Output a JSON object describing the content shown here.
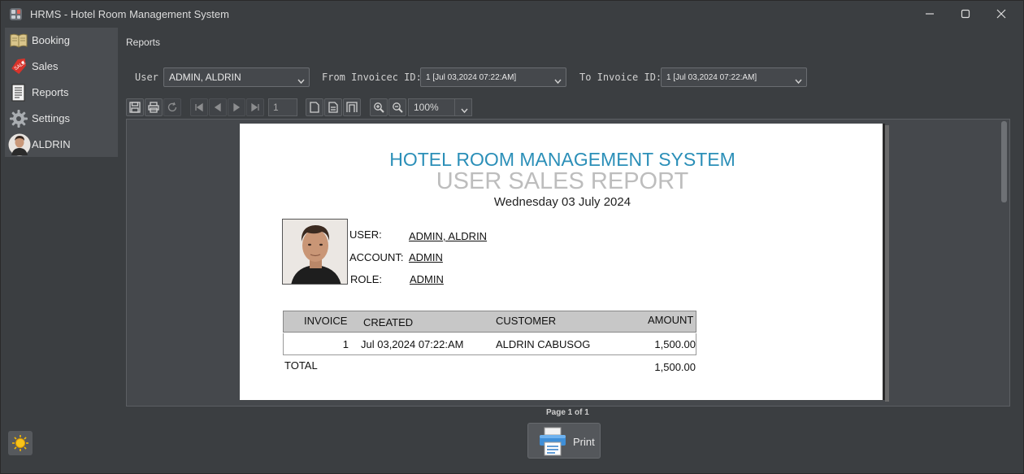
{
  "window": {
    "title": "HRMS - Hotel Room Management System"
  },
  "sidebar": {
    "items": [
      {
        "label": "Booking",
        "icon": "book-icon"
      },
      {
        "label": "Sales",
        "icon": "sale-tag-icon"
      },
      {
        "label": "Reports",
        "icon": "report-document-icon"
      },
      {
        "label": "Settings",
        "icon": "gear-icon"
      },
      {
        "label": "ALDRIN",
        "icon": "user-avatar"
      }
    ]
  },
  "panel": {
    "title": "Reports"
  },
  "filters": {
    "user_label": "User",
    "user_value": "ADMIN, ALDRIN",
    "from_label": "From Invoicec ID:",
    "from_value": "1  [Jul 03,2024 07:22:AM]",
    "to_label": "To Invoice ID:",
    "to_value": "1  [Jul 03,2024 07:22:AM]"
  },
  "toolbar": {
    "page_number": "1",
    "zoom": "100%"
  },
  "report": {
    "heading": "HOTEL ROOM MANAGEMENT SYSTEM",
    "subheading": "USER SALES REPORT",
    "date": "Wednesday 03 July 2024",
    "user_label": "USER:",
    "user_value": "ADMIN, ALDRIN",
    "account_label": "ACCOUNT:",
    "account_value": "ADMIN",
    "role_label": "ROLE:",
    "role_value": "ADMIN",
    "columns": [
      "INVOICE",
      "CREATED",
      "CUSTOMER",
      "AMOUNT"
    ],
    "rows": [
      {
        "invoice": "1",
        "created": "Jul 03,2024 07:22:AM",
        "customer": "ALDRIN CABUSOG",
        "amount": "1,500.00"
      }
    ],
    "total_label": "TOTAL",
    "total_value": "1,500.00"
  },
  "footer": {
    "page_status": "Page 1 of 1",
    "print_label": "Print"
  },
  "colors": {
    "report_heading": "#2b8fb8",
    "report_subheading": "#bdbdbd",
    "window_bg": "#3b3e41",
    "sidebar_bg": "#4a4d51"
  }
}
